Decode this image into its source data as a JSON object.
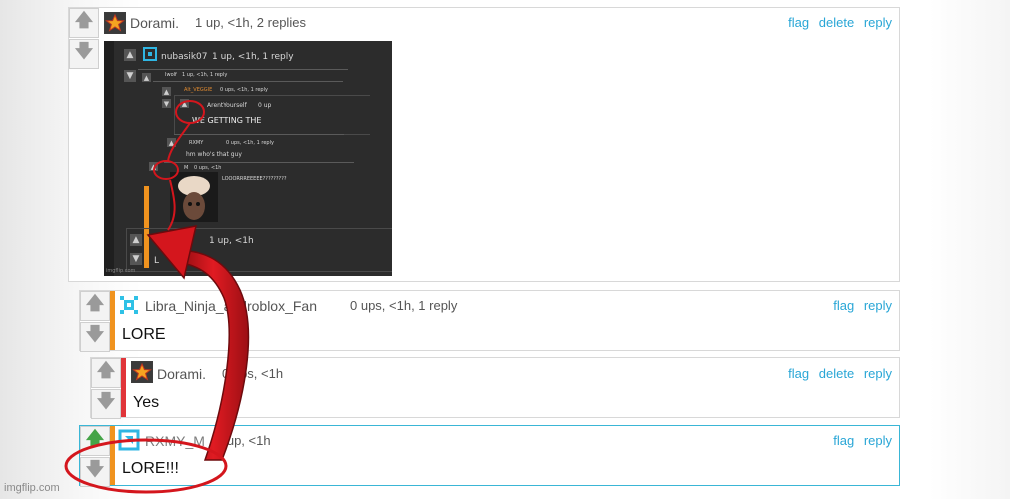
{
  "watermark": "imgflip.com",
  "colors": {
    "link": "#29a6d6",
    "orange_bar": "#f0931f",
    "red_bar": "#e0353a",
    "annotation_red": "#d4161d",
    "active_border": "#3ab6d6"
  },
  "comments": [
    {
      "author": "Dorami.",
      "meta": "1 up, <1h, 2 replies",
      "actions": [
        "flag",
        "delete",
        "reply"
      ],
      "avatar_icon": "star-avatar-icon",
      "embedded_image": {
        "threads": [
          {
            "author": "nubasik07",
            "meta": "1 up, <1h, 1 reply"
          },
          {
            "author": "Iwolf",
            "meta": "1 up, <1h, 1 reply"
          },
          {
            "author": "Alt_VEGGIE",
            "meta": "0 ups, <1h, 1 reply"
          },
          {
            "author": "ArentYourself",
            "meta": "0 up",
            "text": "WE GETTING THE"
          },
          {
            "author": "RXMY",
            "meta": "0 ups, <1h, 1 reply",
            "text": "hm who's that guy"
          },
          {
            "author": "M",
            "meta": "0 ups, <1h",
            "text": "LOOORRREEEEE?????????"
          },
          {
            "author": "",
            "meta": "1 up, <1h",
            "text": "L"
          }
        ],
        "watermark": "imgflip.com"
      }
    },
    {
      "author": "Libra_Ninja_androblox_Fan",
      "meta": "0 ups, <1h, 1 reply",
      "actions": [
        "flag",
        "reply"
      ],
      "avatar_icon": "pixel-avatar-icon",
      "text": "LORE"
    },
    {
      "author": "Dorami.",
      "meta": "0 ups, <1h",
      "actions": [
        "flag",
        "delete",
        "reply"
      ],
      "avatar_icon": "star-avatar-icon",
      "text": "Yes"
    },
    {
      "author": "RXMY_M",
      "meta": "1 up, <1h",
      "actions": [
        "flag",
        "reply"
      ],
      "avatar_icon": "cyan-avatar-icon",
      "text": "LORE!!!"
    }
  ]
}
